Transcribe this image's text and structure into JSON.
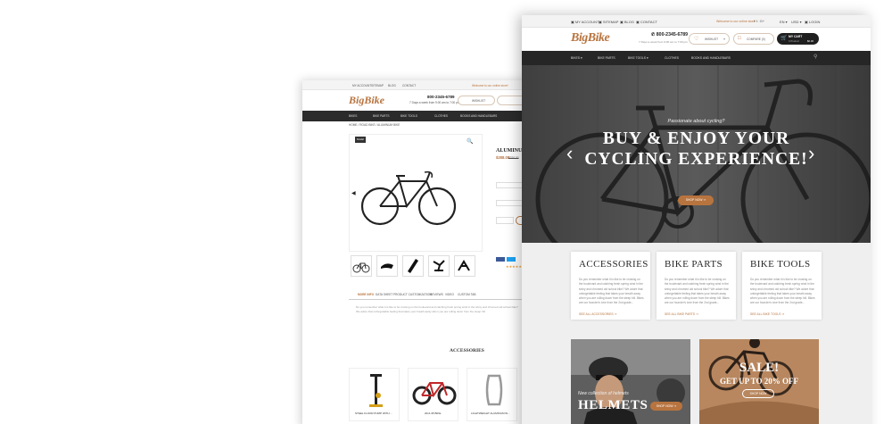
{
  "top_links": {
    "account": "MY ACCOUNT",
    "sitemap": "SITEMAP",
    "blog": "BLOG",
    "contact": "CONTACT"
  },
  "top_right": {
    "welcome": "Welcome to our online store!",
    "lang": "EN",
    "currency": "USD",
    "login": "LOGIN"
  },
  "brand": {
    "logo": "BigBike"
  },
  "phone": {
    "number": "800-2345-6789",
    "hours": "7 Days a week from 9:00 am to 7:00 pm"
  },
  "header": {
    "wishlist": "WISHLIST",
    "compare": "COMPARE (0)",
    "cart_title": "MY CART",
    "cart_items": "0 Product",
    "cart_total": "$0.00"
  },
  "nav": {
    "items": [
      "BIKES",
      "BIKE PARTS",
      "BIKE TOOLS",
      "CLOTHES",
      "BOOKS AND HANDLEBARS"
    ]
  },
  "hero": {
    "tagline": "Passionate about cycling?",
    "headline_1": "BUY & ENJOY YOUR",
    "headline_2": "CYCLING EXPERIENCE!",
    "cta": "SHOP NOW"
  },
  "categories": [
    {
      "title": "ACCESSORIES",
      "text": "Do you remember what it is like to be cruising on the boulevard and catching fresh spring wind in the shiny and chromed old school bike? We adore that unforgettable feeling that takes your breath away when you are rolling down from the steep hill. Bikes are our founder's love from the 2nd grade...",
      "link": "SEE ALL ACCESSORIES"
    },
    {
      "title": "BIKE PARTS",
      "text": "Do you remember what it is like to be cruising on the boulevard and catching fresh spring wind in the shiny and chromed old school bike? We adore that unforgettable feeling that takes your breath away when you are rolling down from the steep hill. Bikes are our founder's love from the 2nd grade...",
      "link": "SEE ALL BIKE PARTS"
    },
    {
      "title": "BIKE TOOLS",
      "text": "Do you remember what it is like to be cruising on the boulevard and catching fresh spring wind in the shiny and chromed old school bike? We adore that unforgettable feeling that takes your breath away when you are rolling down from the steep hill. Bikes are our founder's love from the 2nd grade...",
      "link": "SEE ALL BIKE TOOLS"
    }
  ],
  "promos": {
    "helmets_small": "New collection of helmets",
    "helmets_big": "HELMETS",
    "helmets_cta": "SHOP NOW",
    "sale_title": "SALE!",
    "sale_sub": "GET UP TO 20% OFF",
    "sale_cta": "SHOP NOW"
  },
  "product_page": {
    "breadcrumb": "HOME / ROAD BIKE / ALUMINUM BIKE",
    "sale_badge": "SALE!",
    "title": "ALUMINUM",
    "price": "$288.00",
    "old_price": "$320.00",
    "tabs": [
      "MORE INFO",
      "DATA SHEET",
      "PRODUCT CUSTOMIZATION",
      "REVIEWS",
      "VIDEO",
      "CUSTOM TAB"
    ],
    "desc": "Do you remember what it is like to be cruising on the boulevard and catching fresh spring wind in the shiny and chromed old school bike? We adore that unforgettable feeling that takes your breath away when you are rolling down from the steep hill.",
    "section": "ACCESSORIES",
    "accessories": [
      "STEEL FLOOR PUMP WITH ...",
      "20x1.95 BIKE",
      "LIGHTWEIGHT ALUMINUM W..."
    ]
  },
  "colors": {
    "accent": "#b8743f",
    "dark": "#262626",
    "hero": "#4d4d4d"
  }
}
